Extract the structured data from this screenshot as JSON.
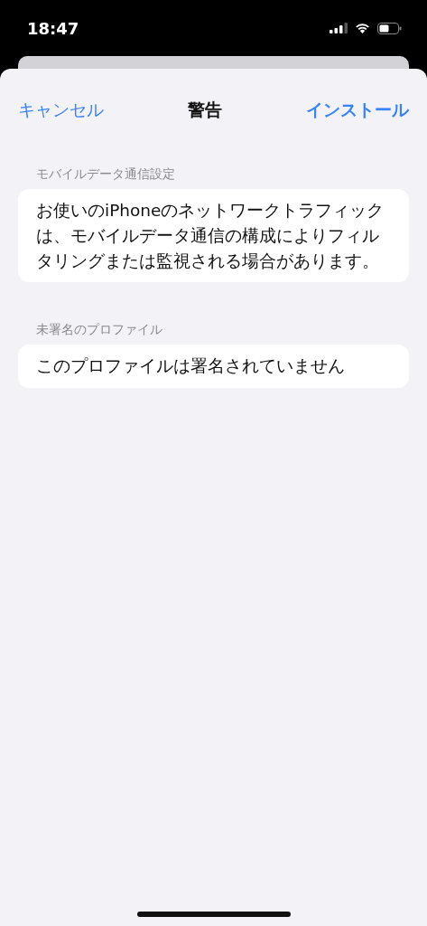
{
  "status_bar": {
    "time": "18:47"
  },
  "nav": {
    "cancel": "キャンセル",
    "title": "警告",
    "install": "インストール"
  },
  "sections": [
    {
      "header": "モバイルデータ通信設定",
      "text": "お使いのiPhoneのネットワークトラフィックは、モバイルデータ通信の構成によりフィルタリングまたは監視される場合があります。"
    },
    {
      "header": "未署名のプロファイル",
      "text": "このプロファイルは署名されていません"
    }
  ]
}
